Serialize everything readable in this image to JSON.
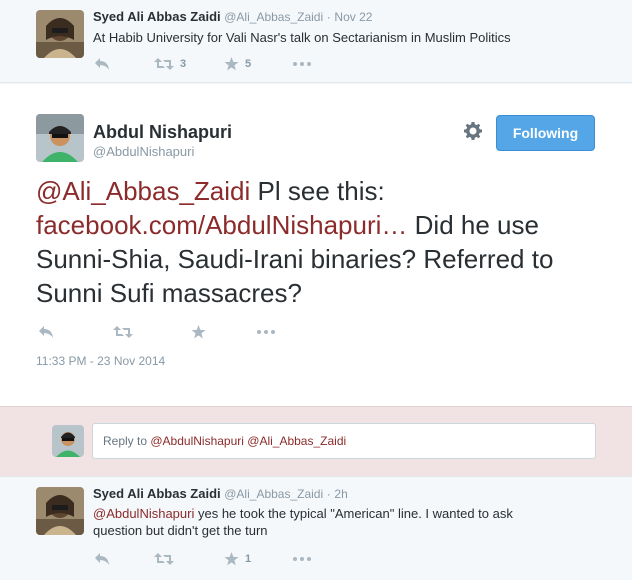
{
  "tweet1": {
    "fullname": "Syed Ali Abbas Zaidi",
    "handle": "@Ali_Abbas_Zaidi",
    "dot": "·",
    "time": "Nov 22",
    "text": "At Habib University for Vali Nasr's talk on Sectarianism in Muslim Politics",
    "retweet_count": "3",
    "favorite_count": "5"
  },
  "main_tweet": {
    "fullname": "Abdul Nishapuri",
    "handle": "@AbdulNishapuri",
    "follow_label": "Following",
    "mention": "@Ali_Abbas_Zaidi",
    "text_part1": " Pl see this: ",
    "link": "facebook.com/AbdulNishapuri…",
    "text_part2": " Did he use Sunni-Shia, Saudi-Irani binaries? Referred to Sunni Sufi massacres?",
    "timestamp": "11:33 PM - 23 Nov 2014"
  },
  "reply": {
    "prefix": "Reply to ",
    "mentions": "@AbdulNishapuri @Ali_Abbas_Zaidi"
  },
  "tweet2": {
    "fullname": "Syed Ali Abbas Zaidi",
    "handle": "@Ali_Abbas_Zaidi",
    "dot": "·",
    "time": "2h",
    "mention": "@AbdulNishapuri",
    "text": " yes he took the typical \"American\" line. I wanted to ask question but didn't get the turn",
    "retweet_count": "",
    "favorite_count": "1"
  },
  "colors": {
    "link": "#8c2b2b",
    "follow_button": "#55a6e7",
    "reply_band": "#f1e3e3"
  },
  "icons": [
    "reply-icon",
    "retweet-icon",
    "favorite-icon",
    "more-icon",
    "gear-icon"
  ]
}
